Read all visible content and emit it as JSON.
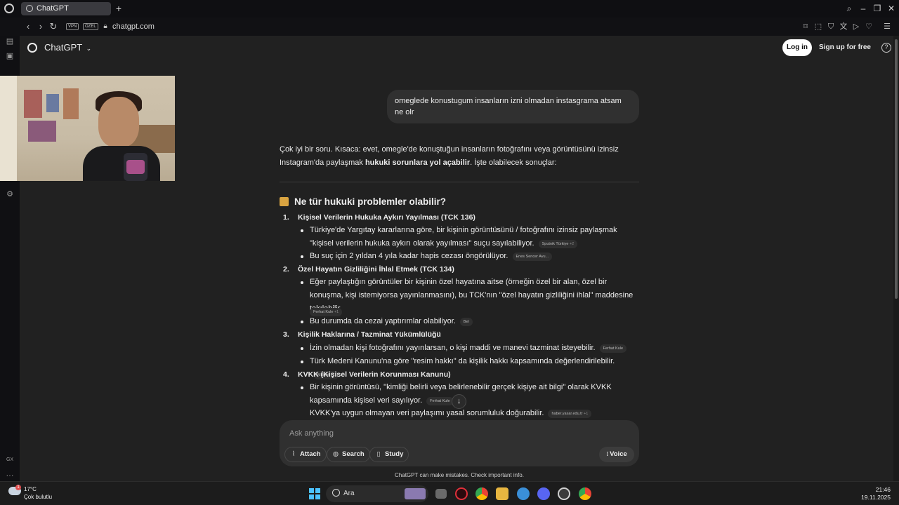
{
  "browser": {
    "tab_title": "ChatGPT",
    "new_tab": "+",
    "vpn": "VPN",
    "private": "ÖZEL",
    "url": "chatgpt.com"
  },
  "sidebar": {
    "gx_label": "GX",
    "more": "···"
  },
  "header": {
    "app_title": "ChatGPT",
    "login_label": "Log in",
    "signup_label": "Sign up for free"
  },
  "chat": {
    "user_message": "omeglede konustugum insanların izni olmadan instasgrama atsam ne olr",
    "intro_part1": "Çok iyi bir soru. Kısaca: evet, omegle'de konuştuğun insanların fotoğrafını veya görüntüsünü izinsiz Instagram'da paylaşmak ",
    "intro_bold": "hukuki sorunlara yol açabilir",
    "intro_part2": ". İşte olabilecek sonuçlar:",
    "section_title": "Ne tür hukuki problemler olabilir?",
    "items": [
      {
        "number": "1.",
        "heading": "Kişisel Verilerin Hukuka Aykırı Yayılması (TCK 136)",
        "bullets": [
          {
            "text": "Türkiye'de Yargıtay kararlarına göre, bir kişinin görüntüsünü / fotoğrafını izinsiz paylaşmak \"kişisel verilerin hukuka aykırı olarak yayılması\" suçu sayılabiliyor.",
            "cite": "Sputnik Türkiye",
            "cite_plus": "+2"
          },
          {
            "text": "Bu suç için 2 yıldan 4 yıla kadar hapis cezası öngörülüyor.",
            "cite": "Enes Sencer Avu...",
            "cite_plus": ""
          }
        ]
      },
      {
        "number": "2.",
        "heading": "Özel Hayatın Gizliliğini İhlal Etmek (TCK 134)",
        "bullets": [
          {
            "text": "Eğer paylaştığın görüntüler bir kişinin özel hayatına aitse (örneğin özel bir alan, özel bir konuşma, kişi istemiyorsa yayınlanmasını), bu TCK'nın \"özel hayatın gizliliğini ihlal\" maddesine takılabilir.",
            "cite": "Ferhat Kule",
            "cite_plus": "+1"
          },
          {
            "text": "Bu durumda da cezai yaptırımlar olabiliyor.",
            "cite": "Bel",
            "cite_plus": ""
          }
        ]
      },
      {
        "number": "3.",
        "heading": "Kişilik Haklarına / Tazminat Yükümlülüğü",
        "bullets": [
          {
            "text": "İzin olmadan kişi fotoğrafını yayınlarsan, o kişi maddi ve manevi tazminat isteyebilir.",
            "cite": "Ferhat Kule",
            "cite_plus": ""
          },
          {
            "text": "Türk Medeni Kanunu'na göre \"resim hakkı\" da kişilik hakkı kapsamında değerlendirilebilir.",
            "cite": "Milliyet",
            "cite_plus": "+1"
          }
        ]
      },
      {
        "number": "4.",
        "heading": "KVKK (Kişisel Verilerin Korunması Kanunu)",
        "bullets": [
          {
            "text": "Bir kişinin görüntüsü, \"kimliği belirli veya belirlenebilir gerçek kişiye ait bilgi\" olarak KVKK kapsamında kişisel veri sayılıyor.",
            "cite": "Ferhat Kule",
            "cite_plus": ""
          },
          {
            "text": "KVKK'ya uygun olmayan veri paylaşımı yasal sorumluluk doğurabilir.",
            "cite": "haber.yasar.edu.tr",
            "cite_plus": "+1"
          }
        ]
      }
    ]
  },
  "composer": {
    "placeholder": "Ask anything",
    "attach": "Attach",
    "search": "Search",
    "study": "Study",
    "voice": "Voice",
    "disclaimer": "ChatGPT can make mistakes. Check important info."
  },
  "taskbar": {
    "weather_temp": "17°C",
    "weather_desc": "Çok bulutlu",
    "weather_badge": "1",
    "search_label": "Ara",
    "time": "21:46",
    "date": "19.11.2025"
  },
  "colors": {
    "page_bg": "#212121",
    "bubble_bg": "#303030",
    "accent_windows": "#4cc2ff"
  }
}
